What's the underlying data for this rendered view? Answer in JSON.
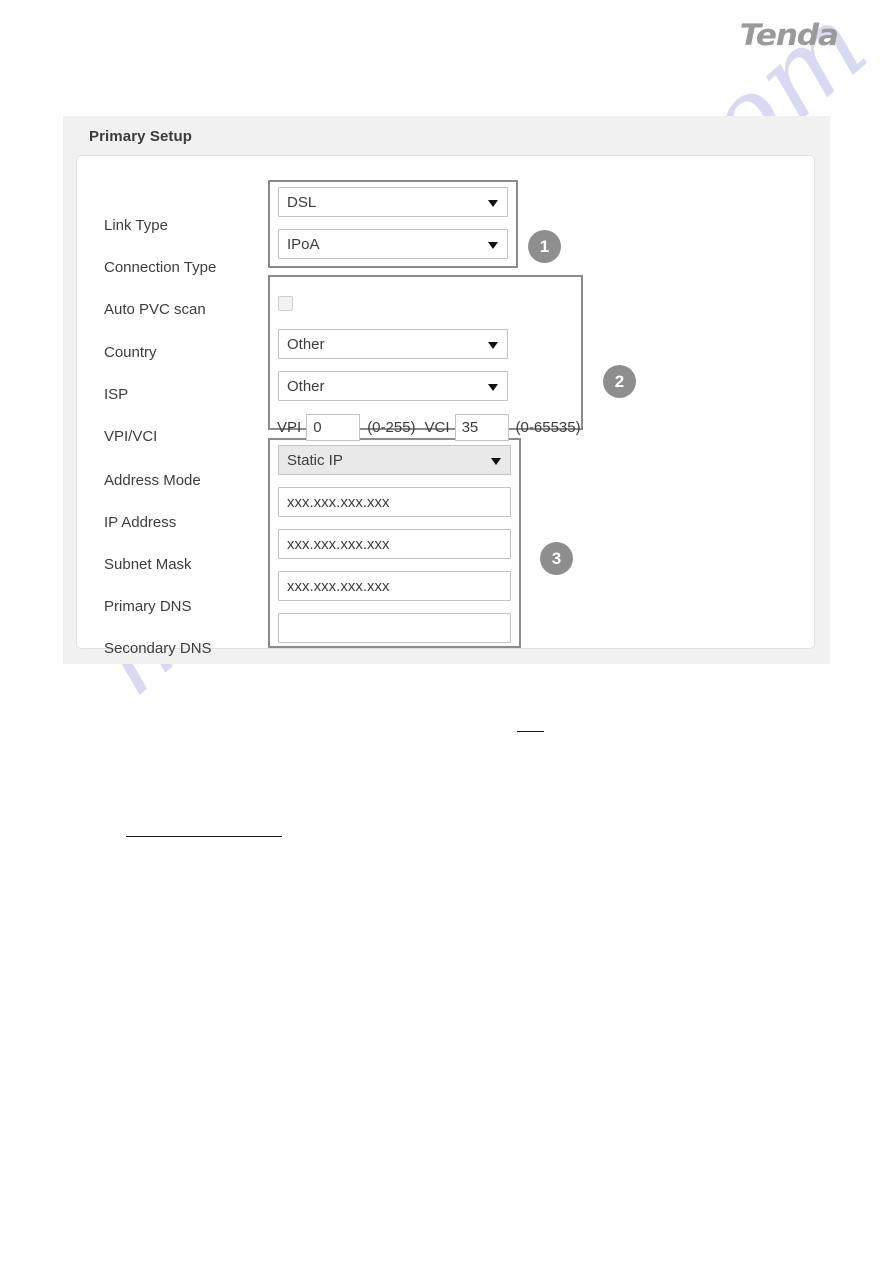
{
  "brand": {
    "logo_text": "Tenda"
  },
  "watermark": {
    "text": "manualshive.com"
  },
  "panel": {
    "title": "Primary Setup",
    "rows": [
      {
        "label": "Link Type"
      },
      {
        "label": "Connection Type"
      },
      {
        "label": "Auto PVC scan"
      },
      {
        "label": "Country"
      },
      {
        "label": "ISP"
      },
      {
        "label": "VPI/VCI"
      },
      {
        "label": "Address Mode"
      },
      {
        "label": "IP Address"
      },
      {
        "label": "Subnet Mask"
      },
      {
        "label": "Primary DNS"
      },
      {
        "label": "Secondary DNS"
      }
    ],
    "fields": {
      "link_type": {
        "value": "DSL"
      },
      "connection_type": {
        "value": "IPoA"
      },
      "auto_pvc_scan": {
        "checked": "false"
      },
      "country": {
        "value": "Other"
      },
      "isp": {
        "value": "Other"
      },
      "vpi": {
        "caption": "VPI",
        "value": "0",
        "range": "(0-255)"
      },
      "vci": {
        "caption": "VCI",
        "value": "35",
        "range": "(0-65535)"
      },
      "address_mode": {
        "value": "Static IP"
      },
      "ip_address": {
        "value": "xxx.xxx.xxx.xxx"
      },
      "subnet_mask": {
        "value": "xxx.xxx.xxx.xxx"
      },
      "primary_dns": {
        "value": "xxx.xxx.xxx.xxx"
      },
      "secondary_dns": {
        "value": ""
      }
    },
    "callouts": [
      {
        "number": "1"
      },
      {
        "number": "2"
      },
      {
        "number": "3"
      }
    ]
  }
}
